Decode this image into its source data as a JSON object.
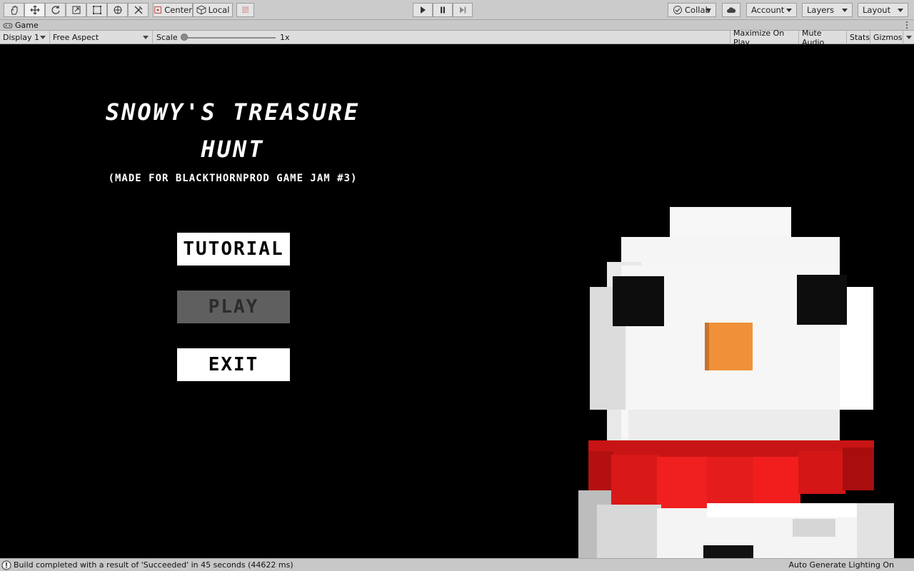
{
  "toolbar": {
    "tools": [
      "hand-icon",
      "move-icon",
      "rotate-icon",
      "scale-icon",
      "rect-icon",
      "transform-icon",
      "custom-tools-icon"
    ],
    "pivot_label": "Center",
    "space_label": "Local",
    "collab_label": "Collab",
    "account_label": "Account",
    "layers_label": "Layers",
    "layout_label": "Layout"
  },
  "tab": {
    "label": "Game"
  },
  "game_controls": {
    "display": "Display 1",
    "aspect": "Free Aspect",
    "scale_label": "Scale",
    "scale_value": "1x",
    "maximize_on_play": "Maximize On Play",
    "mute_audio": "Mute Audio",
    "stats": "Stats",
    "gizmos": "Gizmos"
  },
  "game": {
    "title_line1": "SNOWY'S TREASURE",
    "title_line2": "HUNT",
    "subtitle": "(MADE FOR BLACKTHORNPROD GAME JAM #3)",
    "buttons": [
      {
        "label": "TUTORIAL"
      },
      {
        "label": "PLAY"
      },
      {
        "label": "EXIT"
      }
    ]
  },
  "status": {
    "message": "Build completed with a result of 'Succeeded' in 45 seconds (44622 ms)",
    "right": "Auto Generate Lighting On"
  },
  "colors": {
    "snow": "#f2f2f2",
    "eye": "#0d0d0d",
    "nose": "#f0913a",
    "scarf": "#e31a1a"
  }
}
